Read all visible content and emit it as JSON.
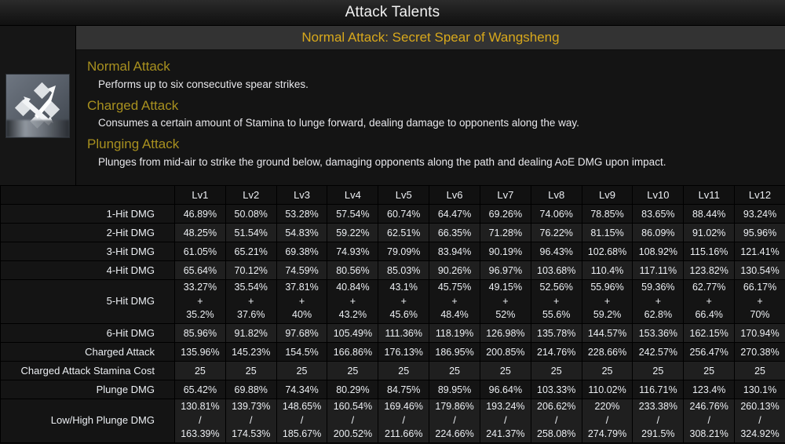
{
  "window": {
    "title": "Attack Talents"
  },
  "talent": {
    "name": "Normal Attack: Secret Spear of Wangsheng",
    "icon": "polearm-normal-attack-icon",
    "sections": [
      {
        "heading": "Normal Attack",
        "text": "Performs up to six consecutive spear strikes."
      },
      {
        "heading": "Charged Attack",
        "text": "Consumes a certain amount of Stamina to lunge forward, dealing damage to opponents along the way."
      },
      {
        "heading": "Plunging Attack",
        "text": "Plunges from mid-air to strike the ground below, damaging opponents along the path and dealing AoE DMG upon impact."
      }
    ]
  },
  "table": {
    "corner_label": "",
    "columns": [
      "Lv1",
      "Lv2",
      "Lv3",
      "Lv4",
      "Lv5",
      "Lv6",
      "Lv7",
      "Lv8",
      "Lv9",
      "Lv10",
      "Lv11",
      "Lv12"
    ],
    "rows": [
      {
        "label": "1-Hit DMG",
        "tall": false,
        "values": [
          "46.89%",
          "50.08%",
          "53.28%",
          "57.54%",
          "60.74%",
          "64.47%",
          "69.26%",
          "74.06%",
          "78.85%",
          "83.65%",
          "88.44%",
          "93.24%"
        ]
      },
      {
        "label": "2-Hit DMG",
        "tall": false,
        "values": [
          "48.25%",
          "51.54%",
          "54.83%",
          "59.22%",
          "62.51%",
          "66.35%",
          "71.28%",
          "76.22%",
          "81.15%",
          "86.09%",
          "91.02%",
          "95.96%"
        ]
      },
      {
        "label": "3-Hit DMG",
        "tall": false,
        "values": [
          "61.05%",
          "65.21%",
          "69.38%",
          "74.93%",
          "79.09%",
          "83.94%",
          "90.19%",
          "96.43%",
          "102.68%",
          "108.92%",
          "115.16%",
          "121.41%"
        ]
      },
      {
        "label": "4-Hit DMG",
        "tall": false,
        "values": [
          "65.64%",
          "70.12%",
          "74.59%",
          "80.56%",
          "85.03%",
          "90.26%",
          "96.97%",
          "103.68%",
          "110.4%",
          "117.11%",
          "123.82%",
          "130.54%"
        ]
      },
      {
        "label": "5-Hit DMG",
        "tall": true,
        "values": [
          "33.27%\n+\n35.2%",
          "35.54%\n+\n37.6%",
          "37.81%\n+\n40%",
          "40.84%\n+\n43.2%",
          "43.1%\n+\n45.6%",
          "45.75%\n+\n48.4%",
          "49.15%\n+\n52%",
          "52.56%\n+\n55.6%",
          "55.96%\n+\n59.2%",
          "59.36%\n+\n62.8%",
          "62.77%\n+\n66.4%",
          "66.17%\n+\n70%"
        ]
      },
      {
        "label": "6-Hit DMG",
        "tall": false,
        "values": [
          "85.96%",
          "91.82%",
          "97.68%",
          "105.49%",
          "111.36%",
          "118.19%",
          "126.98%",
          "135.78%",
          "144.57%",
          "153.36%",
          "162.15%",
          "170.94%"
        ]
      },
      {
        "label": "Charged Attack",
        "tall": false,
        "values": [
          "135.96%",
          "145.23%",
          "154.5%",
          "166.86%",
          "176.13%",
          "186.95%",
          "200.85%",
          "214.76%",
          "228.66%",
          "242.57%",
          "256.47%",
          "270.38%"
        ]
      },
      {
        "label": "Charged Attack Stamina Cost",
        "tall": false,
        "values": [
          "25",
          "25",
          "25",
          "25",
          "25",
          "25",
          "25",
          "25",
          "25",
          "25",
          "25",
          "25"
        ]
      },
      {
        "label": "Plunge DMG",
        "tall": false,
        "values": [
          "65.42%",
          "69.88%",
          "74.34%",
          "80.29%",
          "84.75%",
          "89.95%",
          "96.64%",
          "103.33%",
          "110.02%",
          "116.71%",
          "123.4%",
          "130.1%"
        ]
      },
      {
        "label": "Low/High Plunge DMG",
        "tall": true,
        "values": [
          "130.81%\n/\n163.39%",
          "139.73%\n/\n174.53%",
          "148.65%\n/\n185.67%",
          "160.54%\n/\n200.52%",
          "169.46%\n/\n211.66%",
          "179.86%\n/\n224.66%",
          "193.24%\n/\n241.37%",
          "206.62%\n/\n258.08%",
          "220%\n/\n274.79%",
          "233.38%\n/\n291.5%",
          "246.76%\n/\n308.21%",
          "260.13%\n/\n324.92%"
        ]
      }
    ]
  },
  "colors": {
    "title_gold": "#d8a81c",
    "heading_gold": "#a8901f",
    "body_text": "#e8e8ec",
    "panel_bg": "#141414",
    "name_bar_bg": "#333333"
  }
}
